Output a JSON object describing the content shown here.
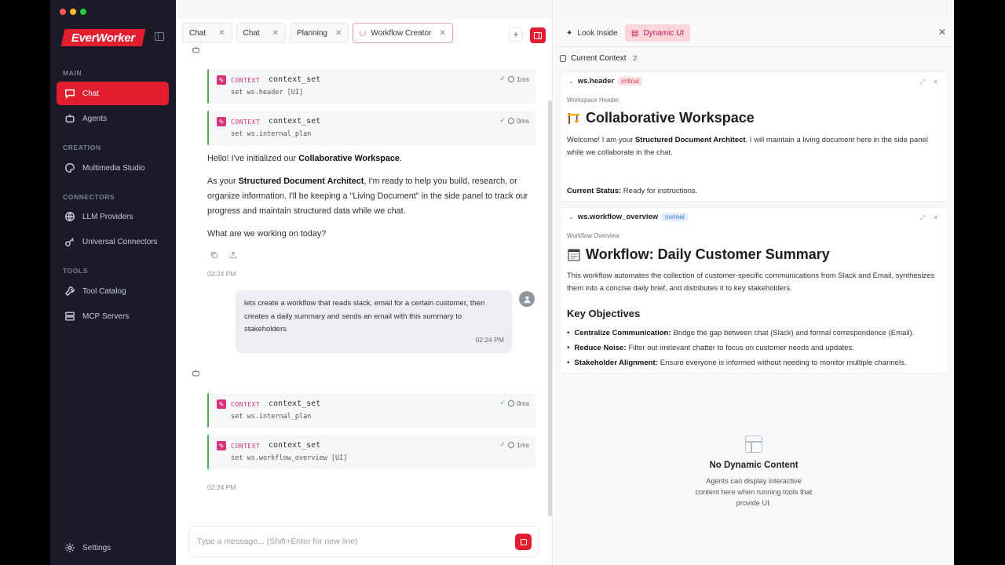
{
  "app": {
    "logo": "EverWorker"
  },
  "sidebar": {
    "sections": [
      {
        "title": "MAIN",
        "items": [
          {
            "label": "Chat",
            "icon": "chat-icon",
            "active": true
          },
          {
            "label": "Agents",
            "icon": "bot-icon"
          }
        ]
      },
      {
        "title": "CREATION",
        "items": [
          {
            "label": "Multimedia Studio",
            "icon": "palette-icon"
          }
        ]
      },
      {
        "title": "CONNECTORS",
        "items": [
          {
            "label": "LLM Providers",
            "icon": "globe-icon"
          },
          {
            "label": "Universal Connectors",
            "icon": "key-icon"
          }
        ]
      },
      {
        "title": "TOOLS",
        "items": [
          {
            "label": "Tool Catalog",
            "icon": "wrench-icon"
          },
          {
            "label": "MCP Servers",
            "icon": "server-icon"
          }
        ]
      }
    ],
    "settings": "Settings"
  },
  "tabs": [
    {
      "label": "Chat"
    },
    {
      "label": "Chat"
    },
    {
      "label": "Planning"
    },
    {
      "label": "Workflow Creator",
      "active": true
    }
  ],
  "messages": {
    "tool_calls_1": [
      {
        "type": "CONTEXT",
        "name": "context_set",
        "arg": "set ws.header [UI]",
        "time": "1ms"
      },
      {
        "type": "CONTEXT",
        "name": "context_set",
        "arg": "set ws.internal_plan",
        "time": "0ms"
      }
    ],
    "assistant_1": {
      "p1_a": "Hello! I've initialized our ",
      "p1_b": "Collaborative Workspace",
      "p1_c": ".",
      "p2_a": "As your ",
      "p2_b": "Structured Document Architect",
      "p2_c": ", I'm ready to help you build, research, or organize information. I'll be keeping a \"Living Document\" in the side panel to track our progress and maintain structured data while we chat.",
      "p3": "What are we working on today?",
      "time": "02:24 PM"
    },
    "user_1": {
      "text": "lets create a workflow that reads slack, email for a certain customer, then creates a daily summary and sends an email with this summary to stakeholders",
      "time": "02:24 PM"
    },
    "tool_calls_2": [
      {
        "type": "CONTEXT",
        "name": "context_set",
        "arg": "set ws.internal_plan",
        "time": "0ms"
      },
      {
        "type": "CONTEXT",
        "name": "context_set",
        "arg": "set ws.workflow_overview [UI]",
        "time": "1ms"
      }
    ],
    "time_2": "02:24 PM"
  },
  "input": {
    "placeholder": "Type a message... (Shift+Enter for new line)"
  },
  "panel": {
    "tabs": [
      {
        "label": "Look Inside"
      },
      {
        "label": "Dynamic UI",
        "active": true
      }
    ],
    "context_title": "Current Context",
    "context_count": "2",
    "cards": [
      {
        "key": "ws.header",
        "priority": "critical",
        "label": "Workspace Header",
        "title": "Collaborative Workspace",
        "body_a": "Welcome! I am your ",
        "body_b": "Structured Document Architect",
        "body_c": ". I will maintain a living document here in the side panel while we collaborate in the chat.",
        "status_label": "Current Status:",
        "status_value": " Ready for instructions."
      },
      {
        "key": "ws.workflow_overview",
        "priority": "normal",
        "label": "Workflow Overview",
        "title": "Workflow: Daily Customer Summary",
        "body": "This workflow automates the collection of customer-specific communications from Slack and Email, synthesizes them into a concise daily brief, and distributes it to key stakeholders.",
        "subheading": "Key Objectives",
        "objectives": [
          {
            "label": "Centralize Communication:",
            "text": "Bridge the gap between chat (Slack) and formal correspondence (Email)."
          },
          {
            "label": "Reduce Noise:",
            "text": "Filter out irrelevant chatter to focus on customer needs and updates."
          },
          {
            "label": "Stakeholder Alignment:",
            "text": "Ensure everyone is informed without needing to monitor multiple channels."
          }
        ]
      }
    ],
    "empty": {
      "title": "No Dynamic Content",
      "subtitle": "Agents can display interactive content here when running tools that provide UI."
    }
  },
  "colors": {
    "accent": "#e11d2f",
    "sidebar_bg": "#1a1b26",
    "context_pink": "#d6337a",
    "success": "#4caf50"
  }
}
